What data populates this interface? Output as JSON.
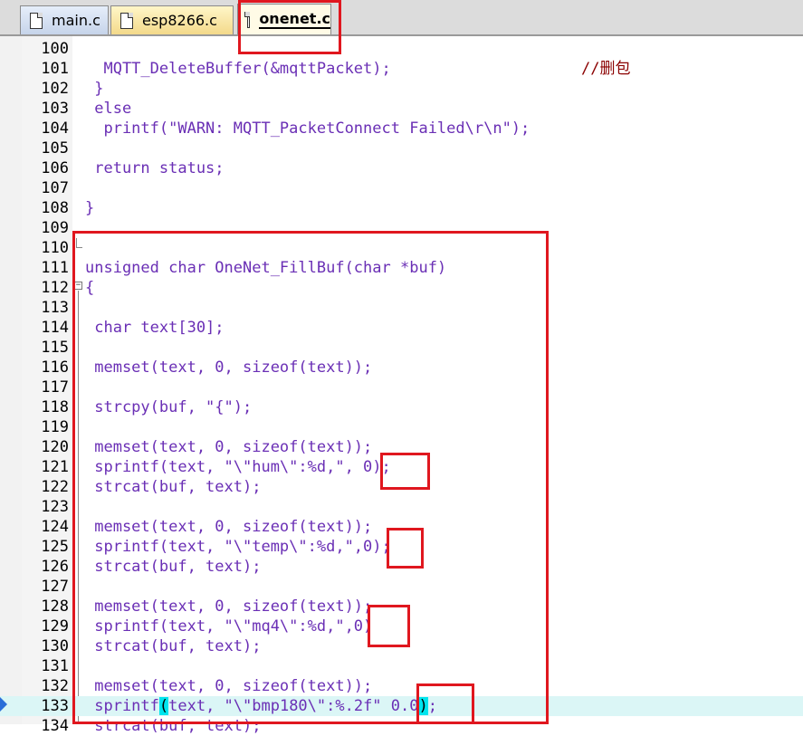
{
  "tabs": [
    {
      "label": "main.c",
      "active": false
    },
    {
      "label": "esp8266.c",
      "active": false
    },
    {
      "label": "onenet.c",
      "active": true
    }
  ],
  "code_lines": [
    {
      "num": "100",
      "text": ""
    },
    {
      "num": "101",
      "text": "  MQTT_DeleteBuffer(&mqttPacket);",
      "comment": "//删包"
    },
    {
      "num": "102",
      "text": " }"
    },
    {
      "num": "103",
      "text": " else"
    },
    {
      "num": "104",
      "text": "  printf(\"WARN: MQTT_PacketConnect Failed\\r\\n\");"
    },
    {
      "num": "105",
      "text": ""
    },
    {
      "num": "106",
      "text": " return status;"
    },
    {
      "num": "107",
      "text": ""
    },
    {
      "num": "108",
      "text": "}"
    },
    {
      "num": "109",
      "text": ""
    },
    {
      "num": "110",
      "text": ""
    },
    {
      "num": "111",
      "text": "unsigned char OneNet_FillBuf(char *buf)"
    },
    {
      "num": "112",
      "text": "{"
    },
    {
      "num": "113",
      "text": ""
    },
    {
      "num": "114",
      "text": " char text[30];"
    },
    {
      "num": "115",
      "text": ""
    },
    {
      "num": "116",
      "text": " memset(text, 0, sizeof(text));"
    },
    {
      "num": "117",
      "text": ""
    },
    {
      "num": "118",
      "text": " strcpy(buf, \"{\");"
    },
    {
      "num": "119",
      "text": ""
    },
    {
      "num": "120",
      "text": " memset(text, 0, sizeof(text));"
    },
    {
      "num": "121",
      "text": " sprintf(text, \"\\\"hum\\\":%d,\", 0);"
    },
    {
      "num": "122",
      "text": " strcat(buf, text);"
    },
    {
      "num": "123",
      "text": ""
    },
    {
      "num": "124",
      "text": " memset(text, 0, sizeof(text));"
    },
    {
      "num": "125",
      "text": " sprintf(text, \"\\\"temp\\\":%d,\",0);"
    },
    {
      "num": "126",
      "text": " strcat(buf, text);"
    },
    {
      "num": "127",
      "text": ""
    },
    {
      "num": "128",
      "text": " memset(text, 0, sizeof(text));"
    },
    {
      "num": "129",
      "text": " sprintf(text, \"\\\"mq4\\\":%d,\",0)"
    },
    {
      "num": "130",
      "text": " strcat(buf, text);"
    },
    {
      "num": "131",
      "text": ""
    },
    {
      "num": "132",
      "text": " memset(text, 0, sizeof(text));"
    },
    {
      "num": "133",
      "text_pre": " sprintf",
      "text_b1": "(",
      "text_mid": "text, \"\\\"bmp180\\\":%.2f\" 0.0",
      "text_b2": ")",
      "text_post": ";"
    },
    {
      "num": "134",
      "text": " strcat(buf, text);"
    }
  ],
  "colors": {
    "code": "#6a2fb5",
    "comment": "#8b0000",
    "annotation": "#e0171f",
    "current_line": "#dbf6f6",
    "brace_match": "#00e5ee"
  }
}
